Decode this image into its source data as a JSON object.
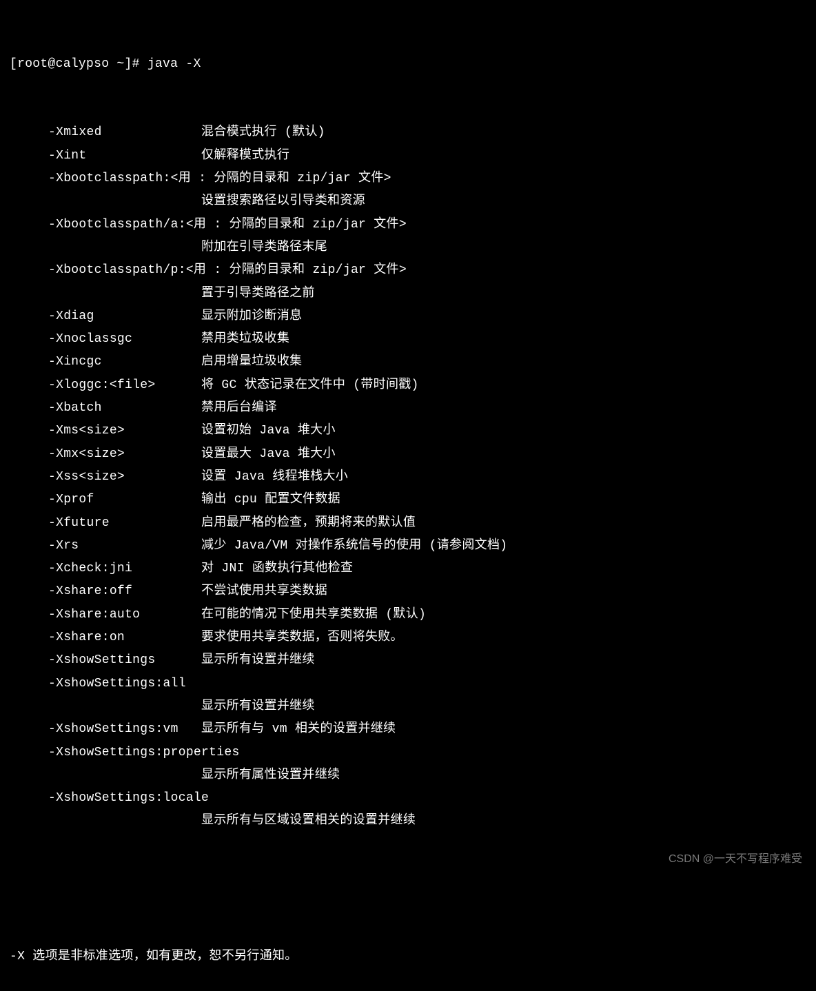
{
  "prompt": "[root@calypso ~]# java -X",
  "options": [
    {
      "flag": "-Xmixed",
      "desc": "混合模式执行 (默认)"
    },
    {
      "flag": "-Xint",
      "desc": "仅解释模式执行"
    },
    {
      "flag": "-Xbootclasspath:<用 : 分隔的目录和 zip/jar 文件>",
      "desc": "",
      "wrap": "设置搜索路径以引导类和资源"
    },
    {
      "flag": "-Xbootclasspath/a:<用 : 分隔的目录和 zip/jar 文件>",
      "desc": "",
      "wrap": "附加在引导类路径末尾"
    },
    {
      "flag": "-Xbootclasspath/p:<用 : 分隔的目录和 zip/jar 文件>",
      "desc": "",
      "wrap": "置于引导类路径之前"
    },
    {
      "flag": "-Xdiag",
      "desc": "显示附加诊断消息"
    },
    {
      "flag": "-Xnoclassgc",
      "desc": "禁用类垃圾收集"
    },
    {
      "flag": "-Xincgc",
      "desc": "启用增量垃圾收集"
    },
    {
      "flag": "-Xloggc:<file>",
      "desc": "将 GC 状态记录在文件中 (带时间戳)"
    },
    {
      "flag": "-Xbatch",
      "desc": "禁用后台编译"
    },
    {
      "flag": "-Xms<size>",
      "desc": "设置初始 Java 堆大小"
    },
    {
      "flag": "-Xmx<size>",
      "desc": "设置最大 Java 堆大小"
    },
    {
      "flag": "-Xss<size>",
      "desc": "设置 Java 线程堆栈大小"
    },
    {
      "flag": "-Xprof",
      "desc": "输出 cpu 配置文件数据"
    },
    {
      "flag": "-Xfuture",
      "desc": "启用最严格的检查，预期将来的默认值"
    },
    {
      "flag": "-Xrs",
      "desc": "减少 Java/VM 对操作系统信号的使用 (请参阅文档)"
    },
    {
      "flag": "-Xcheck:jni",
      "desc": "对 JNI 函数执行其他检查"
    },
    {
      "flag": "-Xshare:off",
      "desc": "不尝试使用共享类数据"
    },
    {
      "flag": "-Xshare:auto",
      "desc": "在可能的情况下使用共享类数据 (默认)"
    },
    {
      "flag": "-Xshare:on",
      "desc": "要求使用共享类数据，否则将失败。"
    },
    {
      "flag": "-XshowSettings",
      "desc": "显示所有设置并继续"
    },
    {
      "flag": "-XshowSettings:all",
      "desc": "",
      "wrap": "显示所有设置并继续"
    },
    {
      "flag": "-XshowSettings:vm",
      "desc": "显示所有与 vm 相关的设置并继续"
    },
    {
      "flag": "-XshowSettings:properties",
      "desc": "",
      "wrap": "显示所有属性设置并继续"
    },
    {
      "flag": "-XshowSettings:locale",
      "desc": "",
      "wrap": "显示所有与区域设置相关的设置并继续"
    }
  ],
  "footer": "-X 选项是非标准选项，如有更改，恕不另行通知。",
  "watermark": "CSDN @一天不写程序难受"
}
